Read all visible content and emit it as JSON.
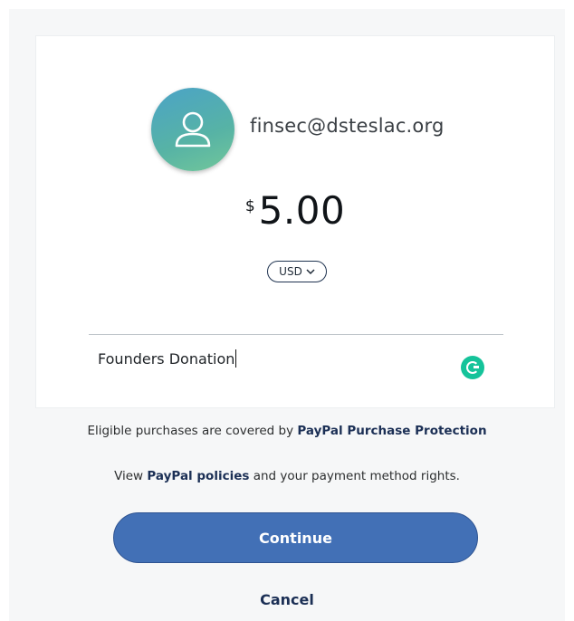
{
  "recipient": {
    "email": "finsec@dsteslac.org",
    "avatar_icon": "user-icon"
  },
  "payment": {
    "currency_symbol": "$",
    "amount": "5.00",
    "currency": "USD",
    "currency_icon": "chevron-down-icon"
  },
  "note": {
    "value": "Founders Donation",
    "grammarly_icon": "grammarly-icon"
  },
  "legal": {
    "protection_prefix": "Eligible purchases are covered by ",
    "protection_link": "PayPal Purchase Protection",
    "policies_prefix": "View ",
    "policies_link": "PayPal policies",
    "policies_suffix": " and your payment method rights."
  },
  "actions": {
    "continue_label": "Continue",
    "cancel_label": "Cancel"
  },
  "colors": {
    "primary_button": "#4270b6",
    "link": "#1b2f55",
    "grammarly": "#15c39a"
  }
}
